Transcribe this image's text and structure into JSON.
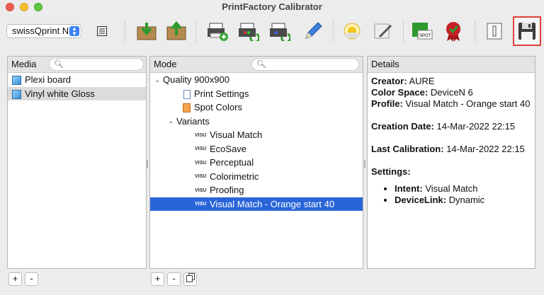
{
  "window": {
    "title": "PrintFactory Calibrator"
  },
  "toolbar": {
    "printer_value": "swissQprint N",
    "buttons": [
      "list-icon",
      "import-icon",
      "export-icon",
      "print-add-icon",
      "print-refresh-green-icon",
      "print-refresh-blue-icon",
      "pencil-icon",
      "sun-icon",
      "certificate-pen-icon",
      "spot-icon",
      "award-ribbon-icon",
      "info-icon",
      "save-icon"
    ]
  },
  "media": {
    "header": "Media",
    "items": [
      "Plexi board",
      "Vinyl white Gloss"
    ]
  },
  "mode": {
    "header": "Mode",
    "quality": "Quality 900x900",
    "print_settings": "Print Settings",
    "spot_colors": "Spot Colors",
    "variants_label": "Variants",
    "visu_badge": "VISU",
    "variants": [
      "Visual Match",
      "EcoSave",
      "Perceptual",
      "Colorimetric",
      "Proofing",
      "Visual Match - Orange start 40"
    ]
  },
  "details": {
    "header": "Details",
    "creator_label": "Creator:",
    "creator_value": "AURE",
    "colorspace_label": "Color Space:",
    "colorspace_value": "DeviceN 6",
    "profile_label": "Profile:",
    "profile_value": "Visual Match - Orange start 40",
    "creation_label": "Creation Date:",
    "creation_value": "14-Mar-2022 22:15",
    "calibration_label": "Last Calibration:",
    "calibration_value": "14-Mar-2022 22:15",
    "settings_label": "Settings:",
    "intent_label": "Intent:",
    "intent_value": "Visual Match",
    "devicelink_label": "DeviceLink:",
    "devicelink_value": "Dynamic"
  },
  "bottom": {
    "add": "+",
    "remove": "-"
  },
  "colors": {
    "selection_blue": "#2a65d8",
    "highlight_red": "#e0413a"
  }
}
